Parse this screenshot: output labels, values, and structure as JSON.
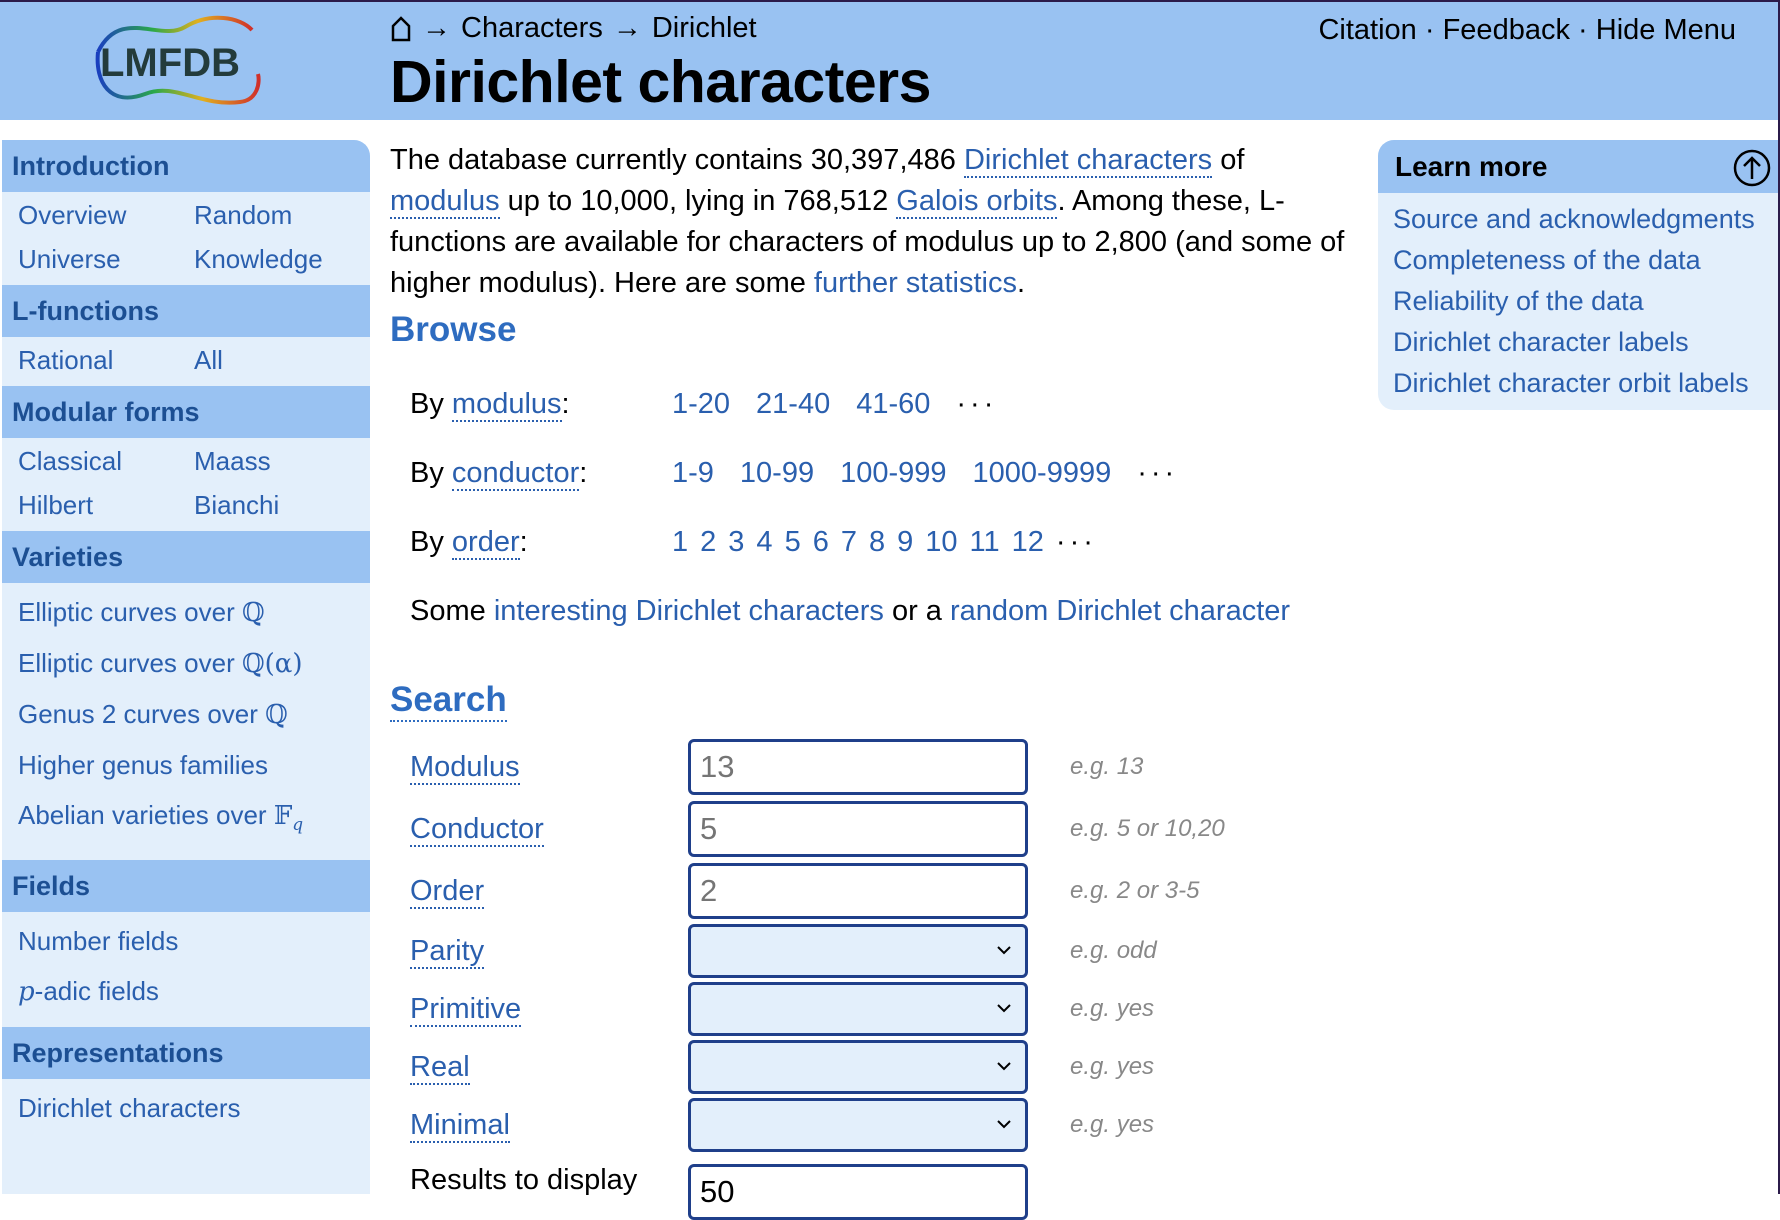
{
  "header": {
    "logo_text": "LMFDB",
    "breadcrumb": [
      "Characters",
      "Dirichlet"
    ],
    "breadcrumb_sep": "→",
    "title": "Dirichlet characters",
    "top_links": [
      "Citation",
      "Feedback",
      "Hide Menu"
    ],
    "top_sep": "·"
  },
  "sidebar": {
    "intro": {
      "title": "Introduction",
      "items": [
        "Overview",
        "Random",
        "Universe",
        "Knowledge"
      ]
    },
    "lfunctions": {
      "title": "L-functions",
      "items": [
        "Rational",
        "All"
      ]
    },
    "modforms": {
      "title": "Modular forms",
      "items": [
        "Classical",
        "Maass",
        "Hilbert",
        "Bianchi"
      ]
    },
    "varieties": {
      "title": "Varieties",
      "items": [
        "Elliptic curves over ",
        "Elliptic curves over ",
        "Genus 2 curves over ",
        "Higher genus families",
        "Abelian varieties over "
      ],
      "q": "ℚ",
      "q_alpha": "ℚ(α)",
      "f_q": "𝔽",
      "q_sub": "q"
    },
    "fields": {
      "title": "Fields",
      "number": "Number fields",
      "p": "p",
      "padic": "-adic fields"
    },
    "reps": {
      "title": "Representations",
      "items": [
        "Dirichlet characters"
      ]
    }
  },
  "intro": {
    "t1": "The database currently contains 30,397,486 ",
    "l1": "Dirichlet characters",
    "t2": " of ",
    "l2": "modulus",
    "t3": " up to 10,000, lying in 768,512 ",
    "l3": "Galois orbits",
    "t4": ". Among these, L-functions are available for characters of modulus up to 2,800 (and some of higher modulus). Here are some ",
    "l4": "further statistics",
    "t5": "."
  },
  "browse": {
    "title": "Browse",
    "rows": [
      {
        "prefix": "By ",
        "knowl": "modulus",
        "values": [
          "1-20",
          "21-40",
          "41-60"
        ]
      },
      {
        "prefix": "By ",
        "knowl": "conductor",
        "values": [
          "1-9",
          "10-99",
          "100-999",
          "1000-9999"
        ]
      },
      {
        "prefix": "By ",
        "knowl": "order",
        "values": [
          "1",
          "2",
          "3",
          "4",
          "5",
          "6",
          "7",
          "8",
          "9",
          "10",
          "11",
          "12"
        ]
      }
    ],
    "colon": ":",
    "ellipsis": "···",
    "some_pre": "Some ",
    "some_link1": "interesting Dirichlet characters",
    "some_mid": " or a ",
    "some_link2": "random Dirichlet character"
  },
  "search": {
    "title": "Search",
    "fields": [
      {
        "label": "Modulus",
        "placeholder": "13",
        "hint": "e.g. 13"
      },
      {
        "label": "Conductor",
        "placeholder": "5",
        "hint": "e.g. 5 or 10,20"
      },
      {
        "label": "Order",
        "placeholder": "2",
        "hint": "e.g. 2 or 3-5"
      }
    ],
    "selects": [
      {
        "label": "Parity",
        "hint": "e.g. odd"
      },
      {
        "label": "Primitive",
        "hint": "e.g. yes"
      },
      {
        "label": "Real",
        "hint": "e.g. yes"
      },
      {
        "label": "Minimal",
        "hint": "e.g. yes"
      }
    ],
    "results_label": "Results to display",
    "results_value": "50"
  },
  "learn_more": {
    "title": "Learn more",
    "items": [
      "Source and acknowledgments",
      "Completeness of the data",
      "Reliability of the data",
      "Dirichlet character labels",
      "Dirichlet character orbit labels"
    ]
  },
  "icons": {
    "home": "home-icon",
    "up": "arrow-up-circle-icon",
    "chevron": "chevron-down-icon"
  },
  "colors": {
    "header_bg": "#99c2f2",
    "panel_bg": "#e3effb",
    "link": "#2a5fae",
    "heading": "#2e6cc0"
  }
}
